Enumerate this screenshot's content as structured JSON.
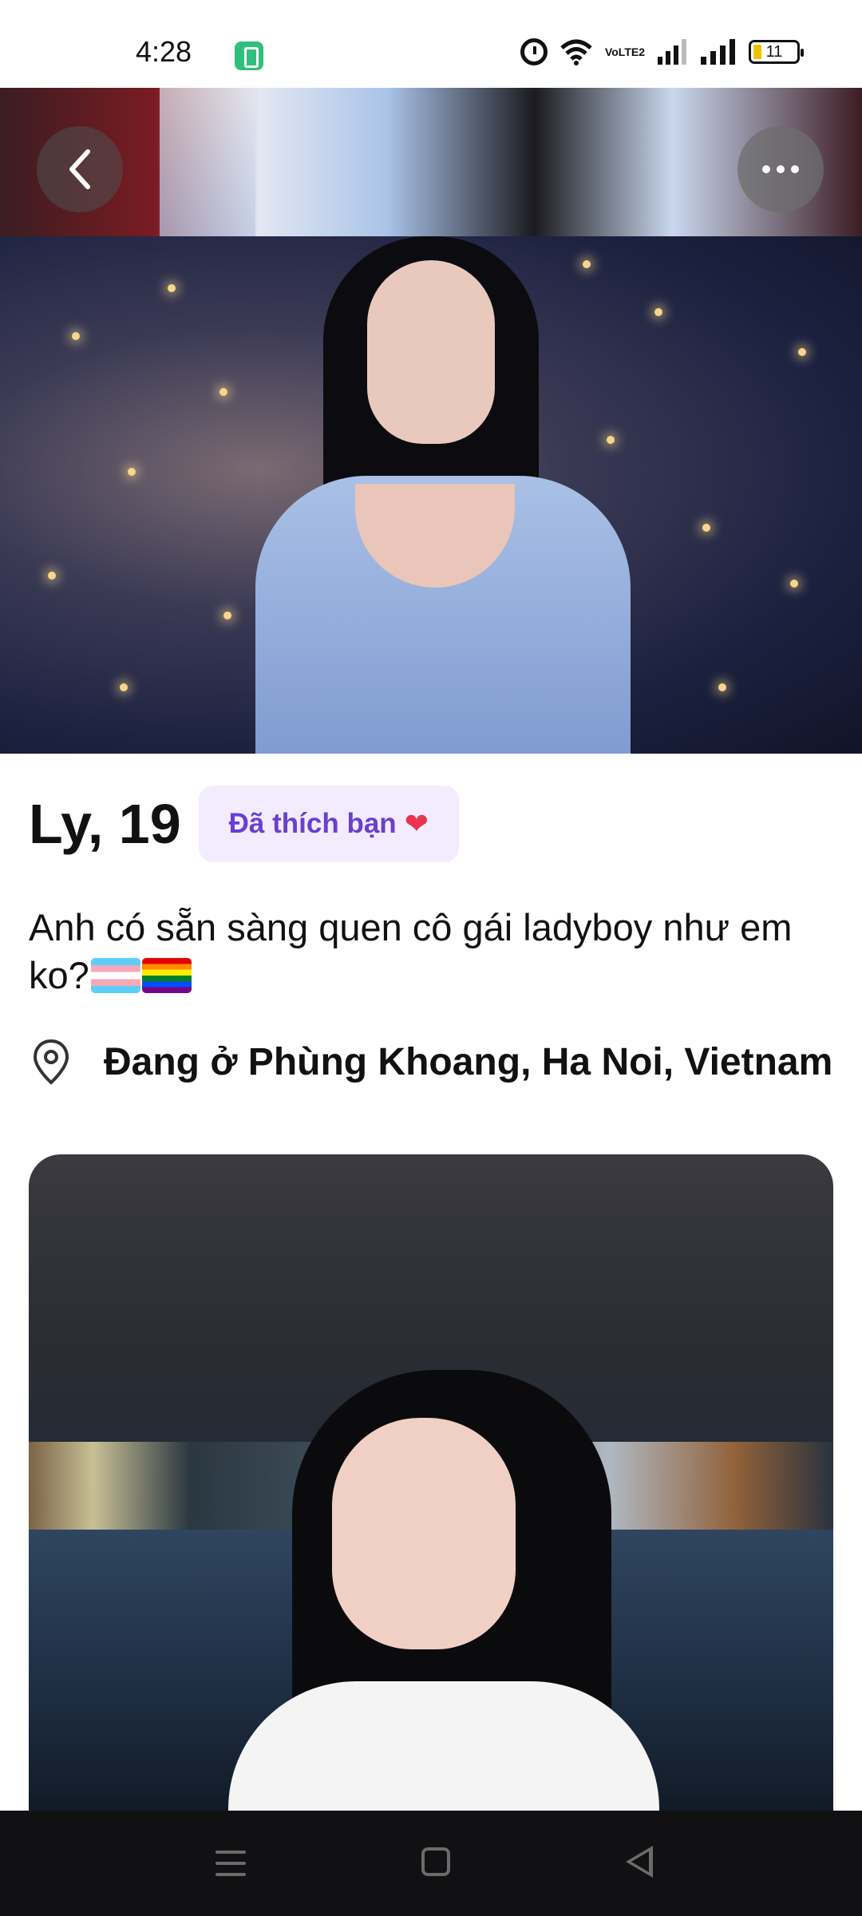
{
  "status_bar": {
    "time": "4:28",
    "network": "VoLTE2",
    "battery_level": "11"
  },
  "profile": {
    "name_age": "Ly, 19",
    "liked_badge": "Đã thích bạn",
    "bio": "Anh có sẵn sàng quen cô gái ladyboy như em ko?",
    "location": "Đang ở Phùng Khoang, Ha Noi, Vietnam"
  },
  "icons": {
    "back": "chevron-left-icon",
    "more": "more-dots-icon",
    "liked": "heart-icon",
    "location": "location-pin-icon"
  },
  "colors": {
    "badge_bg": "#f3ecff",
    "badge_text": "#6a3fd0",
    "nav_bg": "#111113"
  }
}
